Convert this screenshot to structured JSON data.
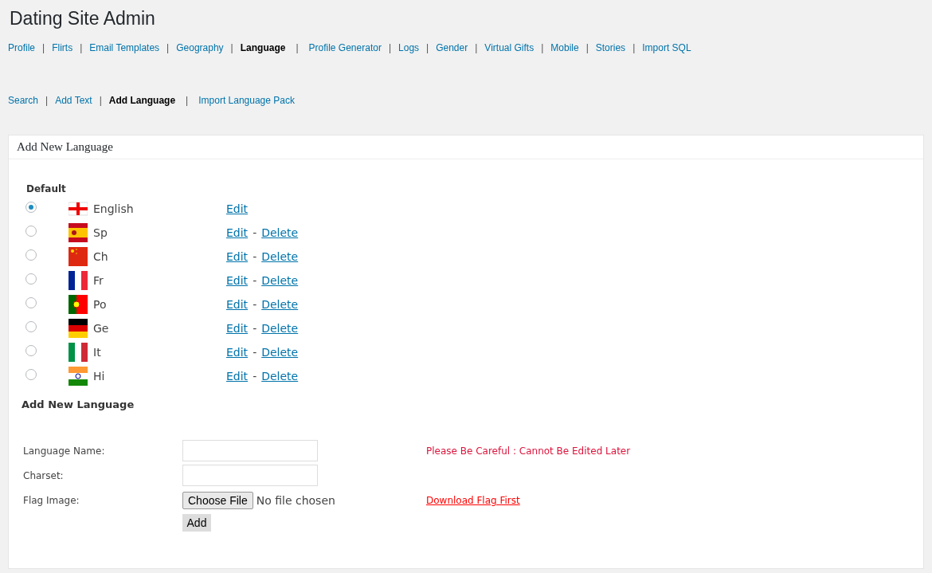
{
  "page_title": "Dating Site Admin",
  "nav": [
    {
      "label": "Profile",
      "selected": false,
      "separator": "|"
    },
    {
      "label": "Flirts",
      "selected": false,
      "separator": "|"
    },
    {
      "label": "Email Templates",
      "selected": false,
      "separator": "|"
    },
    {
      "label": "Geography",
      "selected": false,
      "separator": "|"
    },
    {
      "label": "Language",
      "selected": true,
      "separator": "|"
    },
    {
      "label": "Profile Generator",
      "selected": false,
      "separator": "|"
    },
    {
      "label": "Logs",
      "selected": false,
      "separator": "|"
    },
    {
      "label": "Gender",
      "selected": false,
      "separator": "|"
    },
    {
      "label": "Virtual Gifts",
      "selected": false,
      "separator": "|"
    },
    {
      "label": "Mobile",
      "selected": false,
      "separator": "|"
    },
    {
      "label": "Stories",
      "selected": false,
      "separator": "|"
    },
    {
      "label": "Import SQL",
      "selected": false
    }
  ],
  "subnav": [
    {
      "label": "Search",
      "selected": false,
      "separator": "|"
    },
    {
      "label": "Add Text",
      "selected": false,
      "separator": "|"
    },
    {
      "label": "Add Language",
      "selected": true,
      "separator": "|"
    },
    {
      "label": "Import Language Pack",
      "selected": false
    }
  ],
  "panel": {
    "title": "Add New Language",
    "default_heading": "Default",
    "languages": [
      {
        "name": "English",
        "kind": "england",
        "selected": true,
        "edit": "Edit"
      },
      {
        "name": "Sp",
        "kind": "spain",
        "selected": false,
        "edit": "Edit",
        "dash": "-",
        "delete": "Delete"
      },
      {
        "name": "Ch",
        "kind": "china",
        "selected": false,
        "edit": "Edit",
        "dash": "-",
        "delete": "Delete"
      },
      {
        "name": "Fr",
        "kind": "france",
        "selected": false,
        "edit": "Edit",
        "dash": "-",
        "delete": "Delete"
      },
      {
        "name": "Po",
        "kind": "portugal",
        "selected": false,
        "edit": "Edit",
        "dash": "-",
        "delete": "Delete"
      },
      {
        "name": "Ge",
        "kind": "germany",
        "selected": false,
        "edit": "Edit",
        "dash": "-",
        "delete": "Delete"
      },
      {
        "name": "It",
        "kind": "italy",
        "selected": false,
        "edit": "Edit",
        "dash": "-",
        "delete": "Delete"
      },
      {
        "name": "Hi",
        "kind": "india",
        "selected": false,
        "edit": "Edit",
        "dash": "-",
        "delete": "Delete"
      }
    ],
    "form_heading": "Add New Language",
    "form": [
      {
        "kind": "text",
        "label": "Language Name:",
        "note": "Please Be Careful : Cannot Be Edited Later"
      },
      {
        "kind": "text",
        "label": "Charset:"
      },
      {
        "kind": "file",
        "label": "Flag Image:",
        "button": "Choose File",
        "status": "No file chosen",
        "link": "Download Flag First"
      }
    ],
    "submit": "Add"
  }
}
